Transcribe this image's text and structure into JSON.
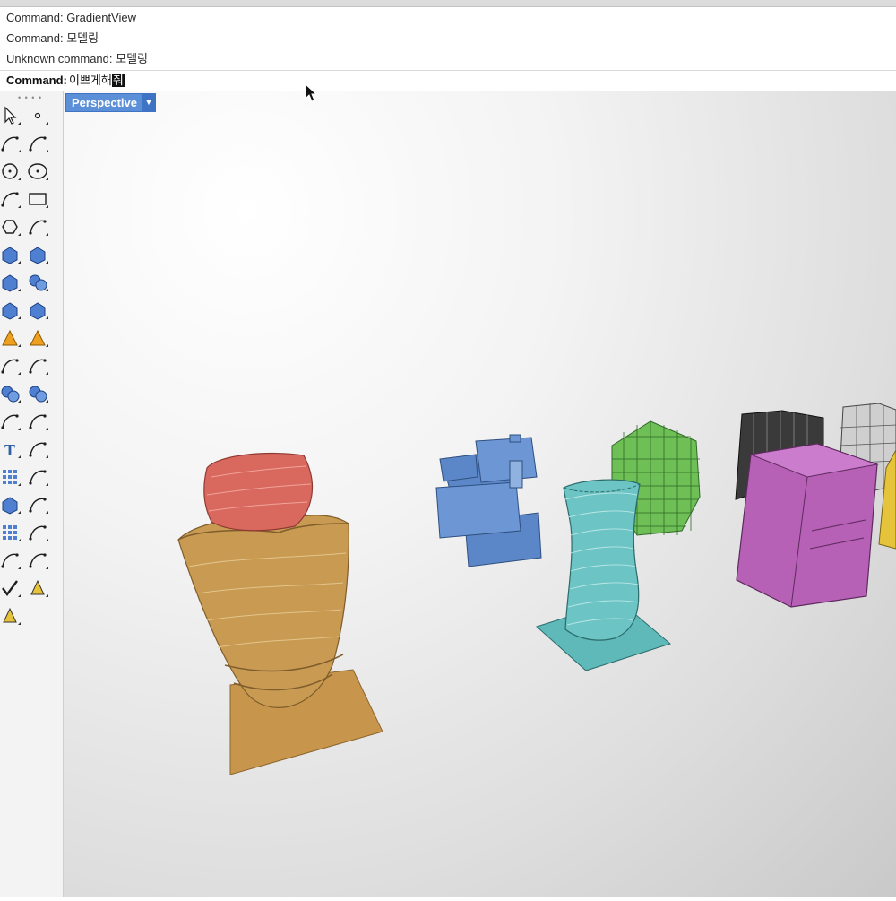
{
  "history": [
    "Command: GradientView",
    "Command: 모델링",
    "Unknown command: 모델링"
  ],
  "command": {
    "label": "Command:",
    "input_text": "이쁘게해",
    "caret_char": "줘"
  },
  "viewport": {
    "name": "Perspective",
    "dropdown_icon": "chevron-down-icon"
  },
  "toolbar": {
    "icons": [
      "select-arrow-icon",
      "point-icon",
      "polyline-icon",
      "curve-icon",
      "circle-icon",
      "ellipse-icon",
      "arc-icon",
      "rectangle-icon",
      "polygon-icon",
      "fillet-curve-icon",
      "surface-icon",
      "loft-surface-icon",
      "box-icon",
      "sphere-icon",
      "cylinder-icon",
      "plane-surface-icon",
      "puzzle-icon",
      "explode-icon",
      "extend-icon",
      "trim-icon",
      "boolean-union-icon",
      "boolean-split-icon",
      "offset-curve-icon",
      "blend-curve-icon",
      "text-icon",
      "scale-icon",
      "array-icon",
      "move-icon",
      "box-edit-icon",
      "gumball-icon",
      "grid-array-icon",
      "history-icon",
      "mirror-icon",
      "orient-icon",
      "check-icon",
      "mesh-icon",
      "render-icon"
    ]
  },
  "colors": {
    "viewport_tab": "#5b8fd8",
    "red_object": "#d9695f",
    "gold_object": "#c89a52",
    "blue_object": "#5b87c8",
    "green_object": "#6fbf57",
    "cyan_object": "#5fb9b9",
    "dark_object": "#3a3a3a",
    "gray_object": "#c8c8c8",
    "purple_object": "#b660b6",
    "yellow_object": "#e5c43b"
  }
}
